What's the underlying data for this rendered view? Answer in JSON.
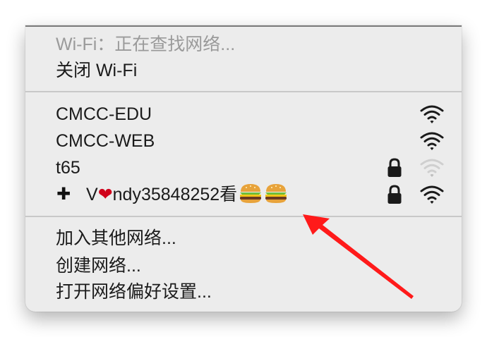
{
  "menu": {
    "status": "Wi-Fi：正在查找网络...",
    "toggle": "关闭 Wi-Fi",
    "networks": [
      {
        "name": "CMCC-EDU",
        "locked": false,
        "signal": "strong"
      },
      {
        "name": "CMCC-WEB",
        "locked": false,
        "signal": "strong"
      },
      {
        "name": "t65",
        "locked": true,
        "signal": "weak"
      }
    ],
    "custom_network": {
      "prefix": "V",
      "heart": "❤",
      "suffix": "ndy35848252看",
      "locked": true,
      "signal": "strong"
    },
    "actions": {
      "join_other": "加入其他网络...",
      "create": "创建网络...",
      "preferences": "打开网络偏好设置..."
    }
  },
  "icons": {
    "wifi": "wifi-icon",
    "lock": "lock-icon",
    "plus": "plus-icon",
    "burger": "hamburger-emoji"
  },
  "colors": {
    "menu_bg": "#ececec",
    "disabled_text": "#9a9a9a",
    "arrow": "#ff1a1a"
  }
}
